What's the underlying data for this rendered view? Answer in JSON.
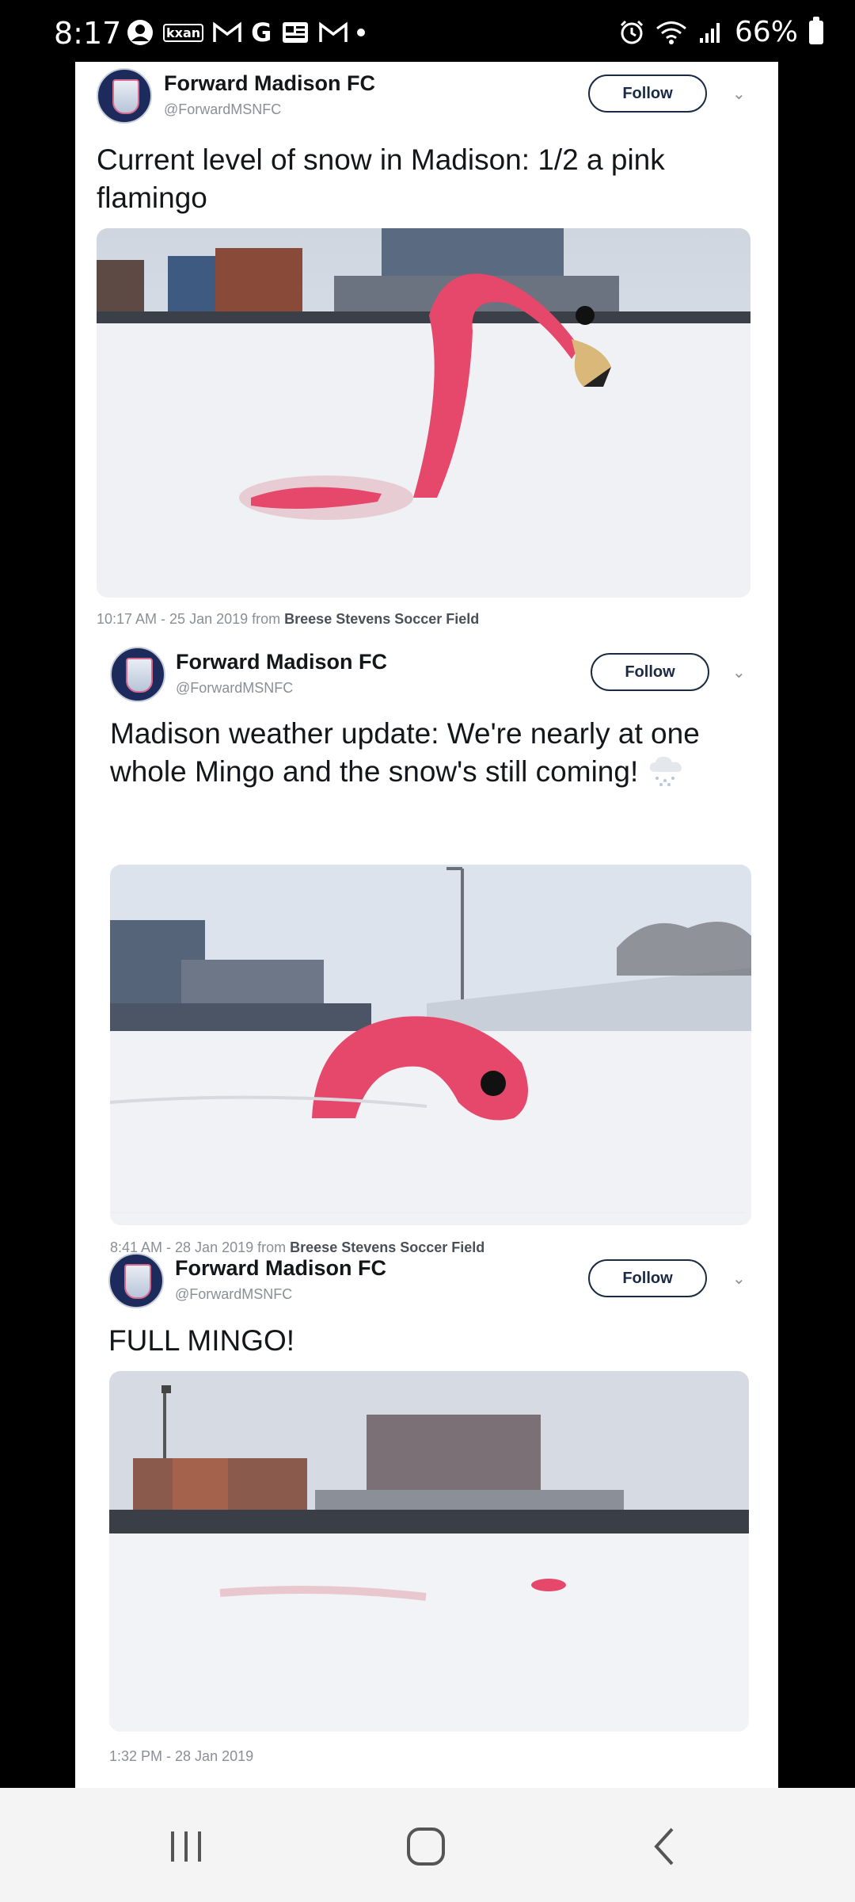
{
  "status_bar": {
    "time": "8:17",
    "notification_icons": [
      "account-circle-icon",
      "kxan-icon",
      "gmail-icon",
      "google-icon",
      "news-icon",
      "gmail-icon",
      "dot-icon"
    ],
    "kxan_text": "kxan",
    "battery": "66%"
  },
  "tweets": [
    {
      "name": "Forward Madison FC",
      "handle": "@ForwardMSNFC",
      "follow_label": "Follow",
      "text": "Current level of snow in Madison: 1/2 a pink flamingo",
      "timestamp": "10:17 AM - 25 Jan 2019 from",
      "location": "Breese Stevens Soccer Field"
    },
    {
      "name": "Forward Madison FC",
      "handle": "@ForwardMSNFC",
      "follow_label": "Follow",
      "text": "Madison weather update: We're nearly at one whole Mingo and the snow's still coming!",
      "emoji": "snow-cloud-icon",
      "timestamp": "8:41 AM - 28 Jan 2019 from",
      "location": "Breese Stevens Soccer Field"
    },
    {
      "name": "Forward Madison FC",
      "handle": "@ForwardMSNFC",
      "follow_label": "Follow",
      "text": "FULL MINGO!",
      "timestamp": "1:32 PM - 28 Jan 2019"
    }
  ],
  "nav_bar": {
    "buttons": [
      "recent-apps-icon",
      "home-icon",
      "back-icon"
    ]
  },
  "colors": {
    "flamingo": "#e5486b",
    "snow": "#f0f1f5",
    "sky": "#dfe3ea",
    "follow_border": "#1b2a44"
  }
}
